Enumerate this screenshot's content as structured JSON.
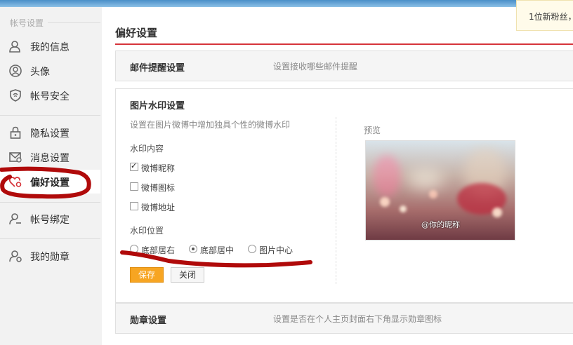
{
  "sidebar": {
    "section_title": "帐号设置",
    "items": [
      {
        "label": "我的信息",
        "icon": "user-icon"
      },
      {
        "label": "头像",
        "icon": "avatar-icon"
      },
      {
        "label": "帐号安全",
        "icon": "shield-icon"
      },
      {
        "label": "隐私设置",
        "icon": "lock-icon"
      },
      {
        "label": "消息设置",
        "icon": "message-icon"
      },
      {
        "label": "偏好设置",
        "icon": "heart-gear-icon",
        "active": true
      },
      {
        "label": "帐号绑定",
        "icon": "user-bind-icon"
      },
      {
        "label": "我的勋章",
        "icon": "medal-icon"
      }
    ]
  },
  "main": {
    "title": "偏好设置",
    "mail_row": {
      "title": "邮件提醒设置",
      "desc": "设置接收哪些邮件提醒"
    },
    "watermark": {
      "title": "图片水印设置",
      "desc": "设置在图片微博中增加独具个性的微博水印",
      "content_label": "水印内容",
      "options": [
        {
          "label": "微博昵称",
          "checked": true
        },
        {
          "label": "微博图标",
          "checked": false
        },
        {
          "label": "微博地址",
          "checked": false
        }
      ],
      "position_label": "水印位置",
      "positions": [
        {
          "label": "底部居右",
          "selected": false
        },
        {
          "label": "底部居中",
          "selected": true
        },
        {
          "label": "图片中心",
          "selected": false
        }
      ],
      "save_label": "保存",
      "close_label": "关闭",
      "preview_label": "预览",
      "preview_watermark": "@你的昵称"
    },
    "medal_row": {
      "title": "勋章设置",
      "desc": "设置是否在个人主页封面右下角显示勋章图标"
    }
  },
  "notice": {
    "text": "1位新粉丝，"
  },
  "colors": {
    "accent_red": "#d6343b",
    "save_orange": "#f7a522",
    "annotation_red": "#b00a0a",
    "topbar_blue": "#4a8fc9"
  }
}
